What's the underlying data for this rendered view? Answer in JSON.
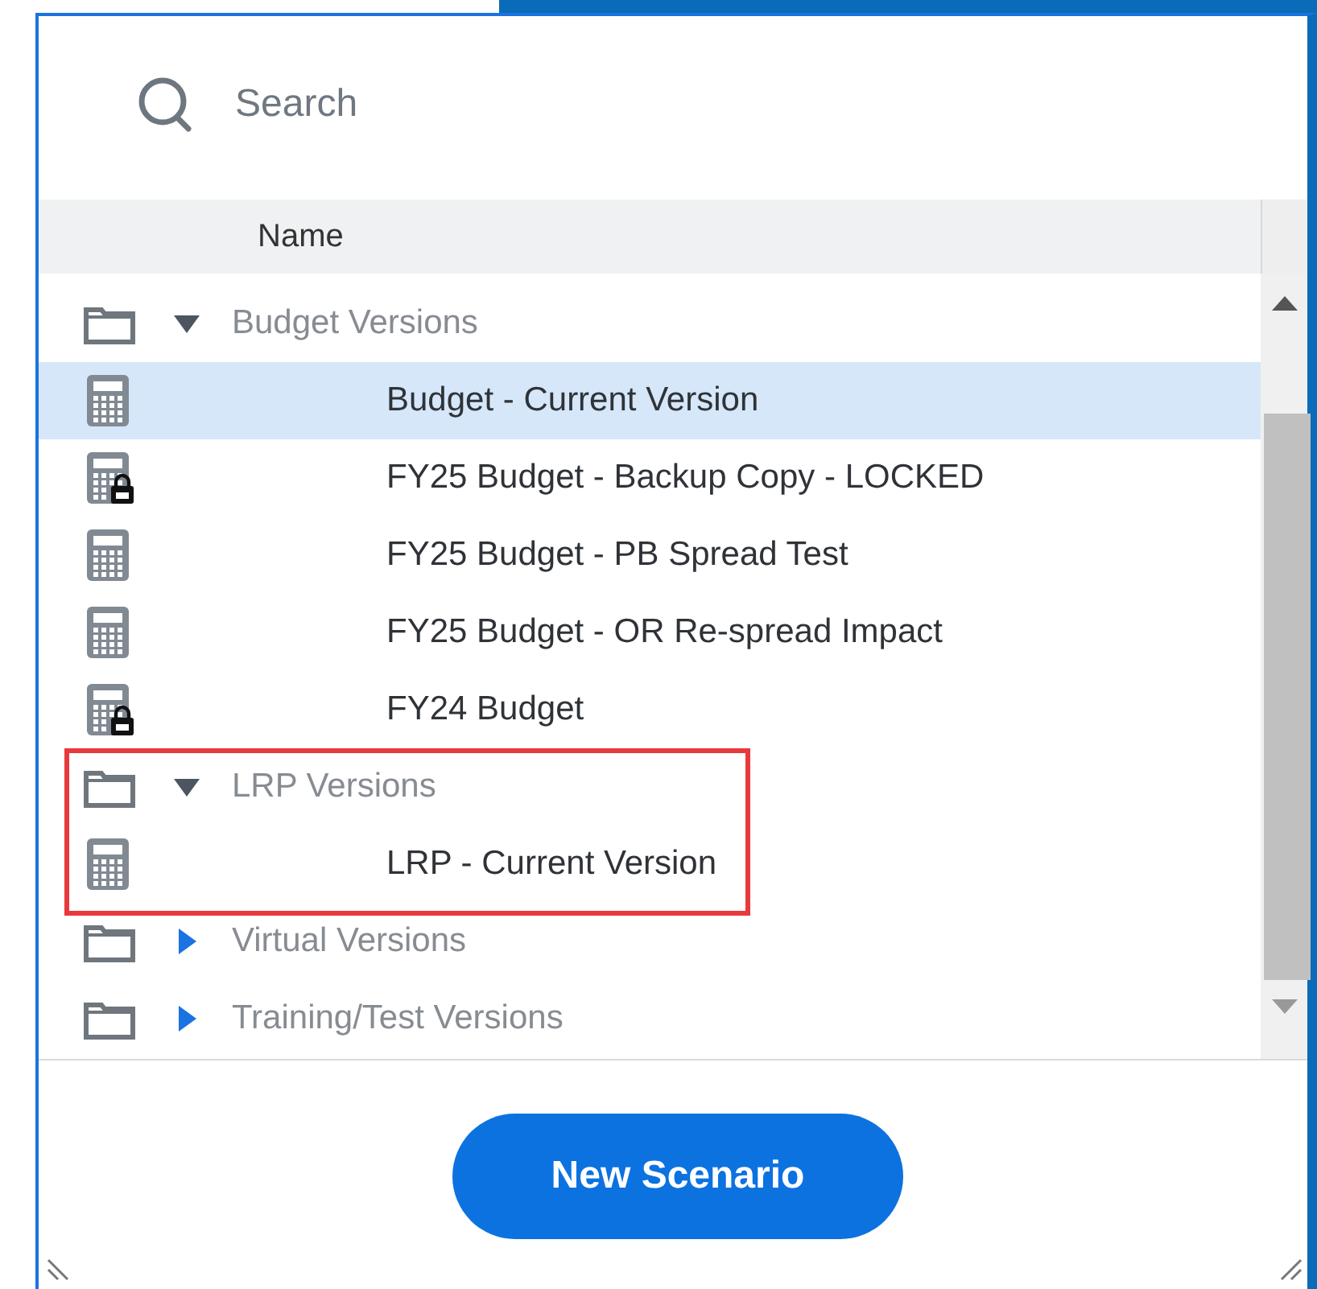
{
  "search": {
    "placeholder": "Search"
  },
  "table": {
    "columns": [
      "Name"
    ]
  },
  "tree": [
    {
      "label": "Budget Versions",
      "expanded": true,
      "highlighted": false,
      "children": [
        {
          "label": "Budget - Current Version",
          "kind": "calculator",
          "selected": true
        },
        {
          "label": "FY25 Budget - Backup Copy - LOCKED",
          "kind": "locked",
          "selected": false
        },
        {
          "label": "FY25 Budget - PB Spread Test",
          "kind": "calculator",
          "selected": false
        },
        {
          "label": "FY25 Budget - OR Re-spread Impact",
          "kind": "calculator",
          "selected": false
        },
        {
          "label": "FY24 Budget",
          "kind": "locked",
          "selected": false
        }
      ]
    },
    {
      "label": "LRP Versions",
      "expanded": true,
      "highlighted": true,
      "children": [
        {
          "label": "LRP - Current Version",
          "kind": "calculator",
          "selected": false
        }
      ]
    },
    {
      "label": "Virtual Versions",
      "expanded": false,
      "highlighted": false
    },
    {
      "label": "Training/Test Versions",
      "expanded": false,
      "highlighted": false
    }
  ],
  "buttons": [
    {
      "label": "New Scenario"
    }
  ]
}
